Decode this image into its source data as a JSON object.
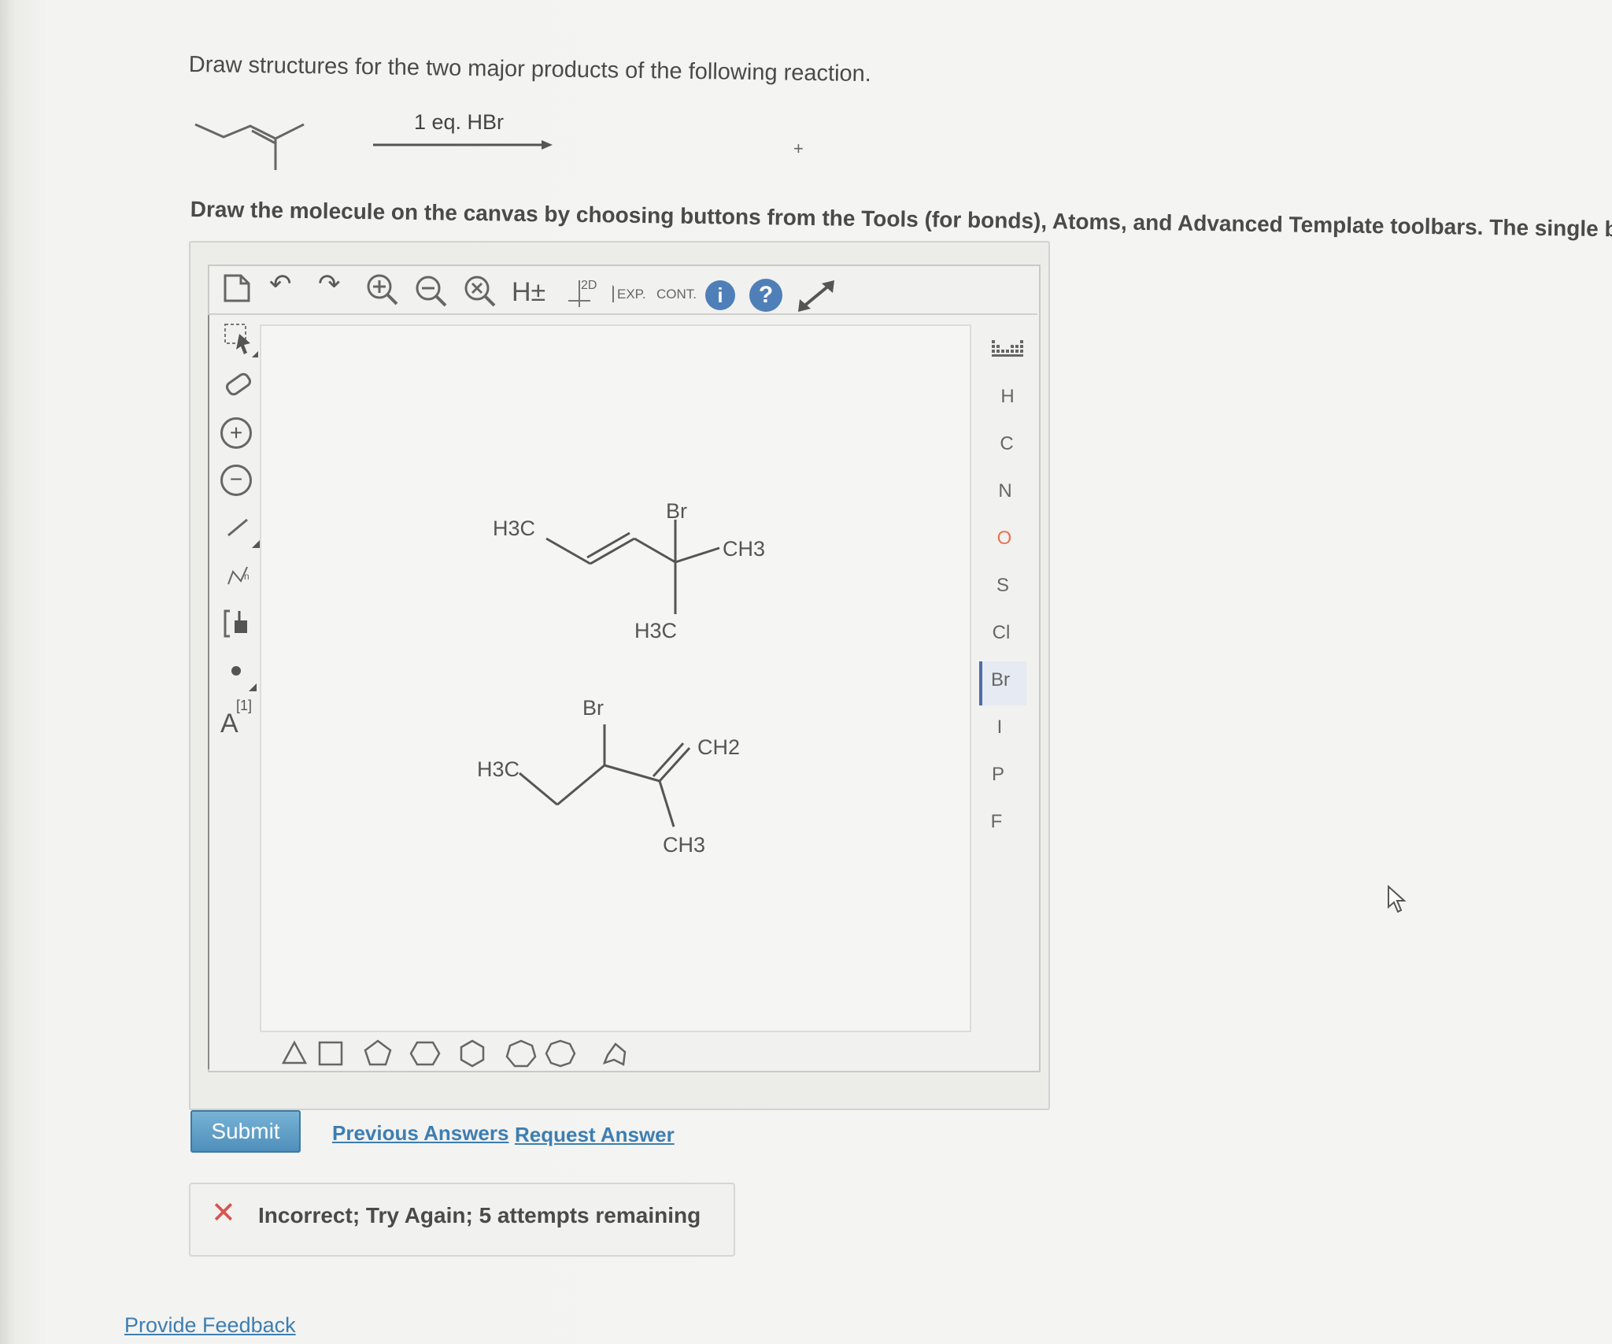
{
  "question": {
    "prompt": "Draw structures for the two major products of the following reaction.",
    "reagent": "1 eq. HBr",
    "plus": "+"
  },
  "instructions": "Draw the molecule on the canvas by choosing buttons from the Tools (for bonds), Atoms, and Advanced Template toolbars. The single bon",
  "top_toolbar": {
    "hydrogen_label": "H±",
    "label_2d": "2D",
    "exp_label": "EXP.",
    "cont_label": "CONT.",
    "info_glyph": "i",
    "help_glyph": "?"
  },
  "left_toolbar": {
    "charge_plus": "+",
    "charge_minus": "−",
    "atom_label": "A",
    "atom_index": "[1]"
  },
  "atoms": [
    "H",
    "C",
    "N",
    "O",
    "S",
    "Cl",
    "Br",
    "I",
    "P",
    "F"
  ],
  "selected_atom": "Br",
  "molecule1": {
    "label_h3c_left": "H3C",
    "label_br": "Br",
    "label_ch3_right": "CH3",
    "label_h3c_bottom": "H3C"
  },
  "molecule2": {
    "label_br": "Br",
    "label_h3c": "H3C",
    "label_ch2": "CH2",
    "label_ch3": "CH3"
  },
  "actions": {
    "submit": "Submit",
    "previous_answers": "Previous Answers",
    "request_answer": "Request Answer"
  },
  "feedback": {
    "icon": "✕",
    "message": "Incorrect; Try Again; 5 attempts remaining"
  },
  "footer": {
    "provide_feedback": "Provide Feedback"
  }
}
